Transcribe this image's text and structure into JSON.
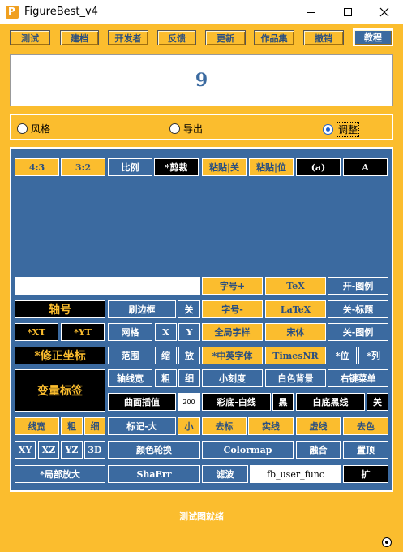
{
  "window": {
    "title": "FigureBest_v4"
  },
  "toolbar": [
    "测试",
    "建档",
    "开发者",
    "反馈",
    "更新",
    "作品集",
    "撤销",
    "教程"
  ],
  "display": {
    "value": "9"
  },
  "radios": [
    {
      "label": "风格",
      "checked": false
    },
    {
      "label": "导出",
      "checked": false
    },
    {
      "label": "调整",
      "checked": true
    }
  ],
  "panel": {
    "r1": [
      "4:3",
      "3:2",
      "比例",
      "*剪裁",
      "粘贴|关",
      "粘贴|位",
      "(a)",
      "A"
    ],
    "r2": [
      "字号+",
      "TeX",
      "开-图例"
    ],
    "r3": [
      "轴号",
      "刷边框",
      "关",
      "字号-",
      "LaTeX",
      "关-标题"
    ],
    "r4": [
      "*XT",
      "*YT",
      "网格",
      "X",
      "Y",
      "全局字样",
      "宋体",
      "关-图例"
    ],
    "r5": [
      "*修正坐标",
      "范围",
      "缩",
      "放",
      "*中英字体",
      "TimesNR",
      "*位",
      "*列"
    ],
    "r6": [
      "变量标签",
      "轴线宽",
      "粗",
      "细",
      "小刻度",
      "白色背景",
      "右键菜单"
    ],
    "r7": [
      "曲面插值",
      "200",
      "彩底-白线",
      "黑",
      "白底黑线",
      "关"
    ],
    "r8": [
      "线宽",
      "粗",
      "细",
      "标记-大",
      "小",
      "去标",
      "实线",
      "虚线",
      "去色"
    ],
    "r9": [
      "XY",
      "XZ",
      "YZ",
      "3D",
      "颜色轮换",
      "Colormap",
      "融合",
      "置顶"
    ],
    "r10": [
      "*局部放大",
      "ShaErr",
      "滤波",
      "fb_user_func",
      "扩"
    ]
  },
  "status": "测试图就绪"
}
